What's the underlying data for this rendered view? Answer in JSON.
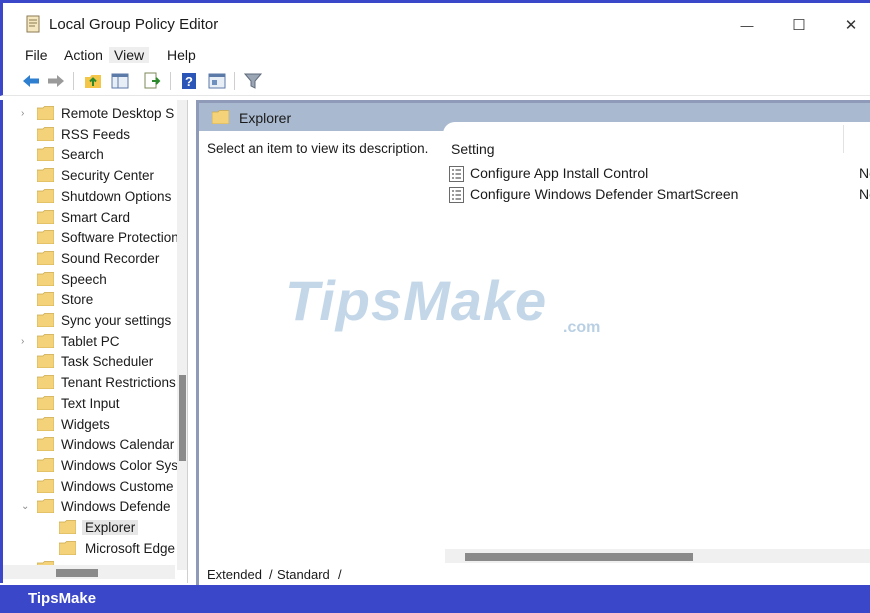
{
  "window": {
    "title": "Local Group Policy Editor",
    "minimize_glyph": "—",
    "maximize_glyph": "☐",
    "close_glyph": "✕"
  },
  "menu": [
    "File",
    "Action",
    "View",
    "Help"
  ],
  "toolbar": {
    "icons": [
      "back-arrow-icon",
      "forward-arrow-icon",
      "folder-up-icon",
      "show-hide-tree-icon",
      "export-list-icon",
      "help-icon",
      "properties-icon",
      "filter-icon"
    ]
  },
  "tree": {
    "items": [
      {
        "label": "Remote Desktop S",
        "chevron": "›"
      },
      {
        "label": "RSS Feeds",
        "chevron": ""
      },
      {
        "label": "Search",
        "chevron": ""
      },
      {
        "label": "Security Center",
        "chevron": ""
      },
      {
        "label": "Shutdown Options",
        "chevron": ""
      },
      {
        "label": "Smart Card",
        "chevron": ""
      },
      {
        "label": "Software Protection",
        "chevron": ""
      },
      {
        "label": "Sound Recorder",
        "chevron": ""
      },
      {
        "label": "Speech",
        "chevron": ""
      },
      {
        "label": "Store",
        "chevron": ""
      },
      {
        "label": "Sync your settings",
        "chevron": ""
      },
      {
        "label": "Tablet PC",
        "chevron": "›"
      },
      {
        "label": "Task Scheduler",
        "chevron": ""
      },
      {
        "label": "Tenant Restrictions",
        "chevron": ""
      },
      {
        "label": "Text Input",
        "chevron": ""
      },
      {
        "label": "Widgets",
        "chevron": ""
      },
      {
        "label": "Windows Calendar",
        "chevron": ""
      },
      {
        "label": "Windows Color Sys",
        "chevron": ""
      },
      {
        "label": "Windows Custome",
        "chevron": ""
      },
      {
        "label": "Windows Defende",
        "chevron": "⌄"
      }
    ],
    "children": [
      {
        "label": "Explorer",
        "selected": true
      },
      {
        "label": "Microsoft Edge",
        "selected": false
      }
    ]
  },
  "right_pane": {
    "header": "Explorer",
    "description_prompt": "Select an item to view its description.",
    "column_setting": "Setting",
    "rows": [
      {
        "label": "Configure App Install Control",
        "state": "No"
      },
      {
        "label": "Configure Windows Defender SmartScreen",
        "state": "No"
      }
    ]
  },
  "tabs": [
    "Extended",
    "Standard"
  ],
  "watermark": {
    "text": "TipsMake",
    "suffix": ".com"
  },
  "footer": {
    "brand": "TipsMake"
  },
  "colors": {
    "frame_blue": "#3a47c8",
    "header_band": "#a9b9d0",
    "folder_yellow": "#f3d27a"
  }
}
